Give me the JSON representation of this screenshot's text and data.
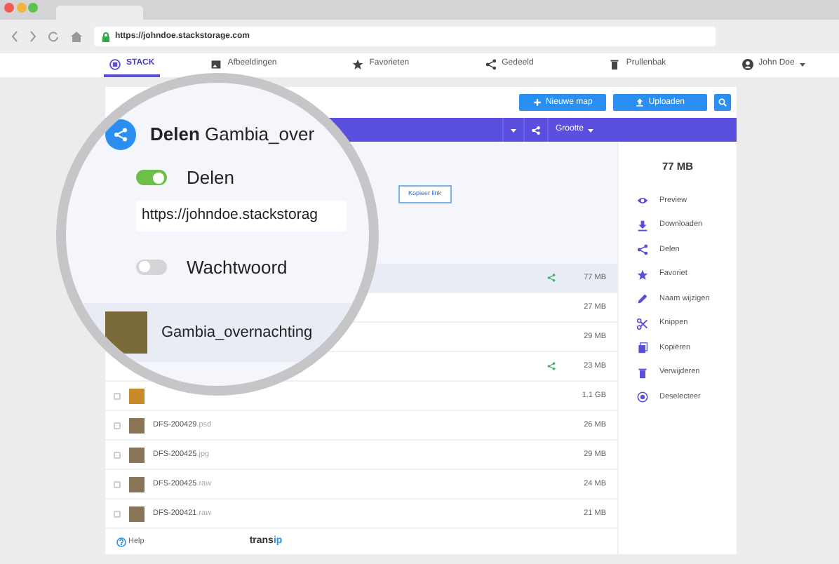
{
  "browser": {
    "url": "https://johndoe.stackstorage.com"
  },
  "nav": [
    {
      "label": "STACK",
      "kind": "stack",
      "selected": true
    },
    {
      "label": "Afbeeldingen",
      "kind": "image",
      "selected": false
    },
    {
      "label": "Favorieten",
      "kind": "star",
      "selected": false
    },
    {
      "label": "Gedeeld",
      "kind": "share",
      "selected": false
    },
    {
      "label": "Prullenbak",
      "kind": "trash",
      "selected": false
    }
  ],
  "user": {
    "name": "John Doe"
  },
  "toolbar": {
    "buttons": [
      {
        "label": "Nieuwe map",
        "kind": "plus"
      },
      {
        "label": "Uploaden",
        "kind": "upload"
      }
    ]
  },
  "table": {
    "size_column": "Grootte",
    "share_panel": {
      "copy_button": "Kopieer link"
    },
    "rows": [
      {
        "size": "77 MB",
        "shared": true,
        "selected": true
      },
      {
        "size": "27 MB",
        "shared": false,
        "selected": false
      },
      {
        "size": "29 MB",
        "shared": false,
        "selected": false
      },
      {
        "size": "23 MB",
        "shared": true,
        "selected": false
      },
      {
        "size": "1.1 GB",
        "shared": false,
        "selected": false,
        "checked": false
      },
      {
        "name": "DFS-200429",
        "ext": ".psd",
        "size": "26 MB",
        "shared": false,
        "selected": false,
        "checked": false
      },
      {
        "name": "DFS-200425",
        "ext": ".jpg",
        "size": "29 MB",
        "shared": false,
        "selected": false,
        "checked": false
      },
      {
        "name": "DFS-200425",
        "ext": ".raw",
        "size": "24 MB",
        "shared": false,
        "selected": false,
        "checked": false
      },
      {
        "name": "DFS-200421",
        "ext": ".raw",
        "size": "21 MB",
        "shared": false,
        "selected": false,
        "checked": false
      }
    ]
  },
  "sidebar": {
    "size": "77 MB",
    "actions": [
      {
        "label": "Preview",
        "kind": "eye"
      },
      {
        "label": "Downloaden",
        "kind": "download"
      },
      {
        "label": "Delen",
        "kind": "share"
      },
      {
        "label": "Favoriet",
        "kind": "star"
      },
      {
        "label": "Naam wijzigen",
        "kind": "pencil"
      },
      {
        "label": "Knippen",
        "kind": "scissors"
      },
      {
        "label": "Kopiëren",
        "kind": "copy"
      },
      {
        "label": "Verwijderen",
        "kind": "trash"
      },
      {
        "label": "Deselecteer",
        "kind": "target"
      }
    ]
  },
  "footer": {
    "help": "Help",
    "logo": "trans",
    "logo_accent": "ip"
  },
  "magnifier": {
    "title_bold": "Delen",
    "title": "Gambia_over",
    "toggles": [
      {
        "label": "Delen",
        "on": true
      },
      {
        "label": "Wachtwoord",
        "on": false
      }
    ],
    "link": "https://johndoe.stackstorag",
    "row_name": "Gambia_overnachting"
  }
}
